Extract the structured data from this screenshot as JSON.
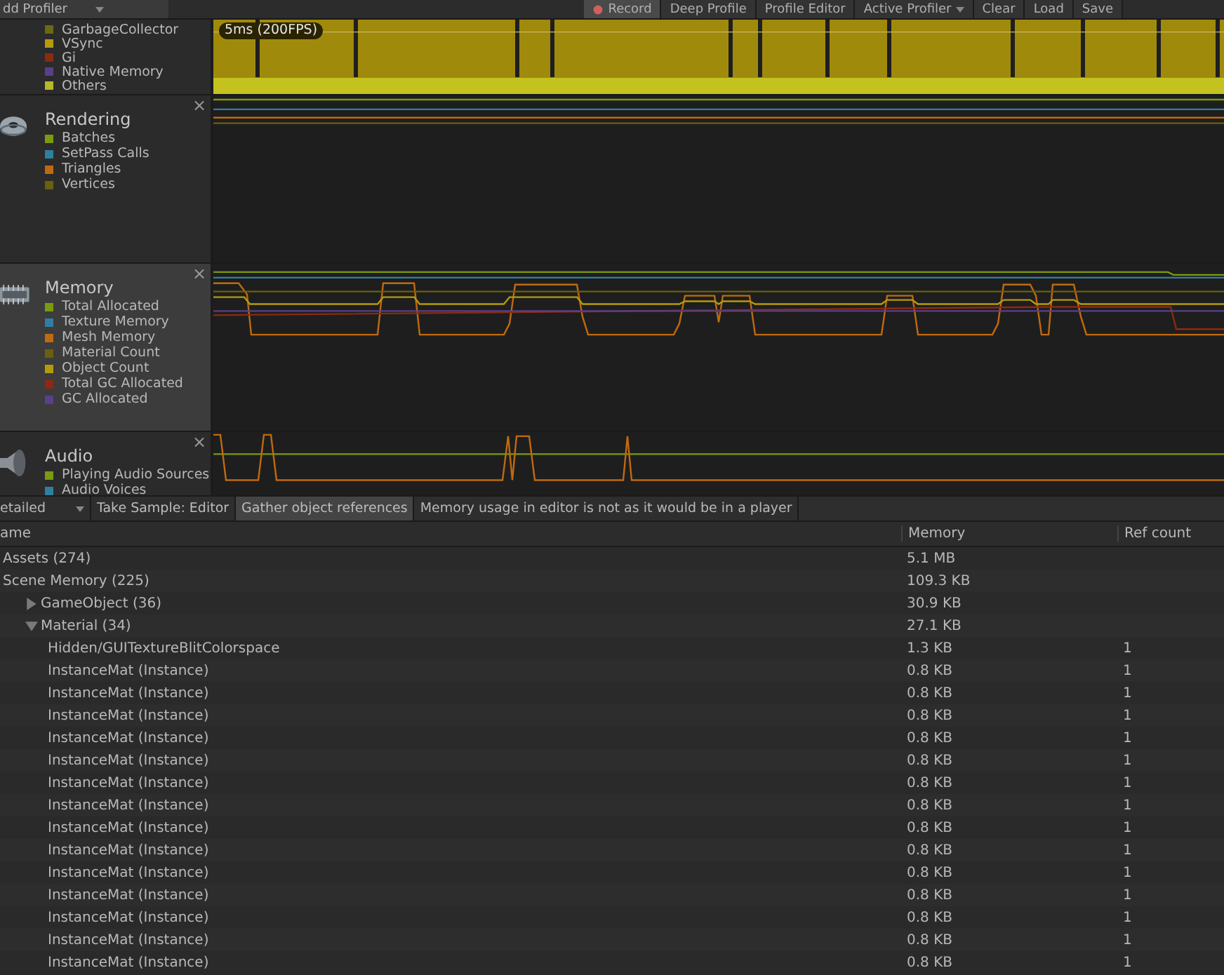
{
  "toolbar": {
    "add_profiler": "dd Profiler",
    "buttons": [
      {
        "label": "Record",
        "on": true,
        "kind": "record"
      },
      {
        "label": "Deep Profile",
        "on": false,
        "kind": "toggle"
      },
      {
        "label": "Profile Editor",
        "on": false,
        "kind": "toggle"
      },
      {
        "label": "Active Profiler",
        "on": false,
        "kind": "dropdown"
      },
      {
        "label": "Clear",
        "on": false,
        "kind": "toggle"
      },
      {
        "label": "Load",
        "on": false,
        "kind": "toggle"
      },
      {
        "label": "Save",
        "on": false,
        "kind": "toggle"
      }
    ]
  },
  "panels": [
    {
      "kind": "cpu",
      "selected": false,
      "chart_label": "5ms (200FPS)",
      "legend": [
        {
          "label": "GarbageCollector",
          "color": "#6b6a10"
        },
        {
          "label": "VSync",
          "color": "#b59b0c"
        },
        {
          "label": "Gi",
          "color": "#8b2a10"
        },
        {
          "label": "Native Memory",
          "color": "#5a3f8a"
        },
        {
          "label": "Others",
          "color": "#b4b82a"
        }
      ]
    },
    {
      "kind": "rendering",
      "selected": false,
      "title": "Rendering",
      "close": "×",
      "legend": [
        {
          "label": "Batches",
          "color": "#7a9a10"
        },
        {
          "label": "SetPass Calls",
          "color": "#2f7fa0"
        },
        {
          "label": "Triangles",
          "color": "#c06a10"
        },
        {
          "label": "Vertices",
          "color": "#6a6010"
        }
      ]
    },
    {
      "kind": "memory",
      "selected": true,
      "title": "Memory",
      "close": "×",
      "legend": [
        {
          "label": "Total Allocated",
          "color": "#7a9a10"
        },
        {
          "label": "Texture Memory",
          "color": "#2f7fa0"
        },
        {
          "label": "Mesh Memory",
          "color": "#c06a10"
        },
        {
          "label": "Material Count",
          "color": "#6a6010"
        },
        {
          "label": "Object Count",
          "color": "#b59b0c"
        },
        {
          "label": "Total GC Allocated",
          "color": "#8b2a10"
        },
        {
          "label": "GC Allocated",
          "color": "#5a3f8a"
        }
      ]
    },
    {
      "kind": "audio",
      "selected": false,
      "title": "Audio",
      "close": "×",
      "legend": [
        {
          "label": "Playing Audio Sources",
          "color": "#7a9a10"
        },
        {
          "label": "Audio Voices",
          "color": "#2f7fa0"
        }
      ]
    }
  ],
  "memory_toolbar": {
    "mode": "etailed",
    "take_sample": "Take Sample: Editor",
    "gather": {
      "label": "Gather object references",
      "on": true
    },
    "notice": "Memory usage in editor is not as it would be in a player"
  },
  "table": {
    "columns": [
      "ame",
      "Memory",
      "Ref count"
    ],
    "rows": [
      {
        "name": "Assets (274)",
        "memory": "5.1 MB"
      },
      {
        "name": "Scene Memory (225)",
        "memory": "109.3 KB",
        "children": [
          {
            "name": "GameObject (36)",
            "memory": "30.9 KB",
            "expanded": false
          },
          {
            "name": "Material (34)",
            "memory": "27.1 KB",
            "expanded": true,
            "children": [
              {
                "name": "Hidden/GUITextureBlitColorspace",
                "memory": "1.3 KB",
                "ref_count": "1"
              },
              {
                "name": "InstanceMat (Instance)",
                "memory": "0.8 KB",
                "ref_count": "1"
              },
              {
                "name": "InstanceMat (Instance)",
                "memory": "0.8 KB",
                "ref_count": "1"
              },
              {
                "name": "InstanceMat (Instance)",
                "memory": "0.8 KB",
                "ref_count": "1"
              },
              {
                "name": "InstanceMat (Instance)",
                "memory": "0.8 KB",
                "ref_count": "1"
              },
              {
                "name": "InstanceMat (Instance)",
                "memory": "0.8 KB",
                "ref_count": "1"
              },
              {
                "name": "InstanceMat (Instance)",
                "memory": "0.8 KB",
                "ref_count": "1"
              },
              {
                "name": "InstanceMat (Instance)",
                "memory": "0.8 KB",
                "ref_count": "1"
              },
              {
                "name": "InstanceMat (Instance)",
                "memory": "0.8 KB",
                "ref_count": "1"
              },
              {
                "name": "InstanceMat (Instance)",
                "memory": "0.8 KB",
                "ref_count": "1"
              },
              {
                "name": "InstanceMat (Instance)",
                "memory": "0.8 KB",
                "ref_count": "1"
              },
              {
                "name": "InstanceMat (Instance)",
                "memory": "0.8 KB",
                "ref_count": "1"
              },
              {
                "name": "InstanceMat (Instance)",
                "memory": "0.8 KB",
                "ref_count": "1"
              },
              {
                "name": "InstanceMat (Instance)",
                "memory": "0.8 KB",
                "ref_count": "1"
              },
              {
                "name": "InstanceMat (Instance)",
                "memory": "0.8 KB",
                "ref_count": "1"
              }
            ]
          }
        ]
      }
    ]
  }
}
